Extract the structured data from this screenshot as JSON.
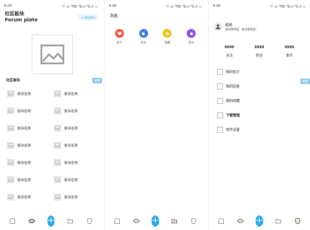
{
  "status": {
    "time": "6:00",
    "icons": "ⓑ ≋ ¹HD ⁴G.ıl ⁵G.ıl ▭"
  },
  "forum": {
    "title": "社区板块",
    "subtitle": "Forum plate",
    "add_label": "+ 添加版块",
    "section_title": "社区板块",
    "edit_label": "编辑",
    "items_left": [
      "板块名称",
      "板块名称",
      "板块名称",
      "板块名称",
      "板块名称",
      "板块名称",
      "板块名称"
    ],
    "items_right": [
      "板块名称",
      "板块名称",
      "板块名称",
      "板块名称",
      "板块名称",
      "板块名称",
      "板块名称"
    ]
  },
  "messages": {
    "title": "消息",
    "categories": [
      {
        "label": "帖子",
        "color": "#f05a4b"
      },
      {
        "label": "评论",
        "color": "#3d7fe6"
      },
      {
        "label": "收藏",
        "color": "#f5c024"
      },
      {
        "label": "官方",
        "color": "#8a4fe0"
      }
    ]
  },
  "profile": {
    "name": "昵称",
    "description": "能承蒙厚爱，能承蒙厚爱!",
    "edit_label": "编辑",
    "stats": [
      {
        "value": "9999",
        "label": "关注"
      },
      {
        "value": "9999",
        "label": "粉丝"
      },
      {
        "value": "9999",
        "label": "金币"
      }
    ],
    "menu": [
      "我的帖子",
      "我的回复",
      "我的收藏",
      "下载管理",
      "软件设置"
    ]
  },
  "tabbar": {
    "center_symbol": "+"
  }
}
